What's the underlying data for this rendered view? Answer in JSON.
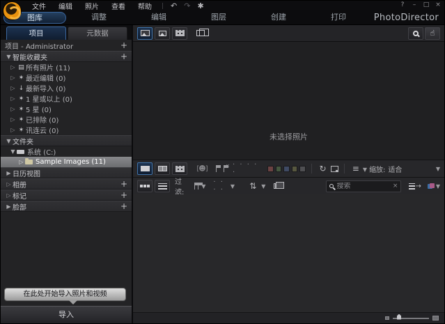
{
  "titlebar": {
    "menus": [
      "文件",
      "编辑",
      "照片",
      "查看",
      "帮助"
    ],
    "undo_icon": "↶",
    "redo_icon": "↷",
    "settings_icon": "✱",
    "window_controls": [
      "?",
      "–",
      "□",
      "×"
    ]
  },
  "modebar": {
    "tabs": [
      "图库",
      "调整",
      "编辑",
      "图层",
      "创建",
      "打印"
    ],
    "active_tab": "图库",
    "app_title": "PhotoDirector"
  },
  "left_panel": {
    "tabs": [
      "项目",
      "元数据"
    ],
    "active_tab": "项目",
    "project_row": "项目 - Administrator",
    "smart_header": "智能收藏夹",
    "smart_items": [
      {
        "icon": "▤",
        "label": "所有照片 (11)"
      },
      {
        "icon": "✶",
        "label": "最近编辑 (0)"
      },
      {
        "icon": "↓",
        "label": "最新导入 (0)"
      },
      {
        "icon": "✶",
        "label": "1 星或以上 (0)"
      },
      {
        "icon": "✶",
        "label": "5 星 (0)"
      },
      {
        "icon": "✶",
        "label": "已排除 (0)"
      },
      {
        "icon": "✶",
        "label": "讯连云 (0)"
      }
    ],
    "folders_header": "文件夹",
    "drive_item": "系统 (C:)",
    "selected_folder": "Sample Images (11)",
    "calendar_header": "日历视图",
    "albums_header": "相册",
    "tags_header": "标记",
    "faces_header": "脸部",
    "import_tooltip": "在此处开始导入照片和视频",
    "import_button": "导入"
  },
  "main": {
    "canvas_placeholder": "未选择照片",
    "toolbar": {
      "rating_dots": "· · · · ·",
      "color_labels": [
        "#6b4242",
        "#45573f",
        "#3f4a63",
        "#57573f",
        "#4f4f52"
      ],
      "rotate_icon": "↻",
      "sort_icon": "≡",
      "zoom_label": "缩放:",
      "zoom_value": "适合"
    },
    "filterbar": {
      "filter_label": "过滤:",
      "rating_filter_dots": "· · · ·",
      "sort_glyph": "⇅",
      "search_placeholder": "搜索"
    }
  },
  "colors": {
    "accent_blue": "#3f72a8",
    "selection_gray": "#77787a"
  }
}
